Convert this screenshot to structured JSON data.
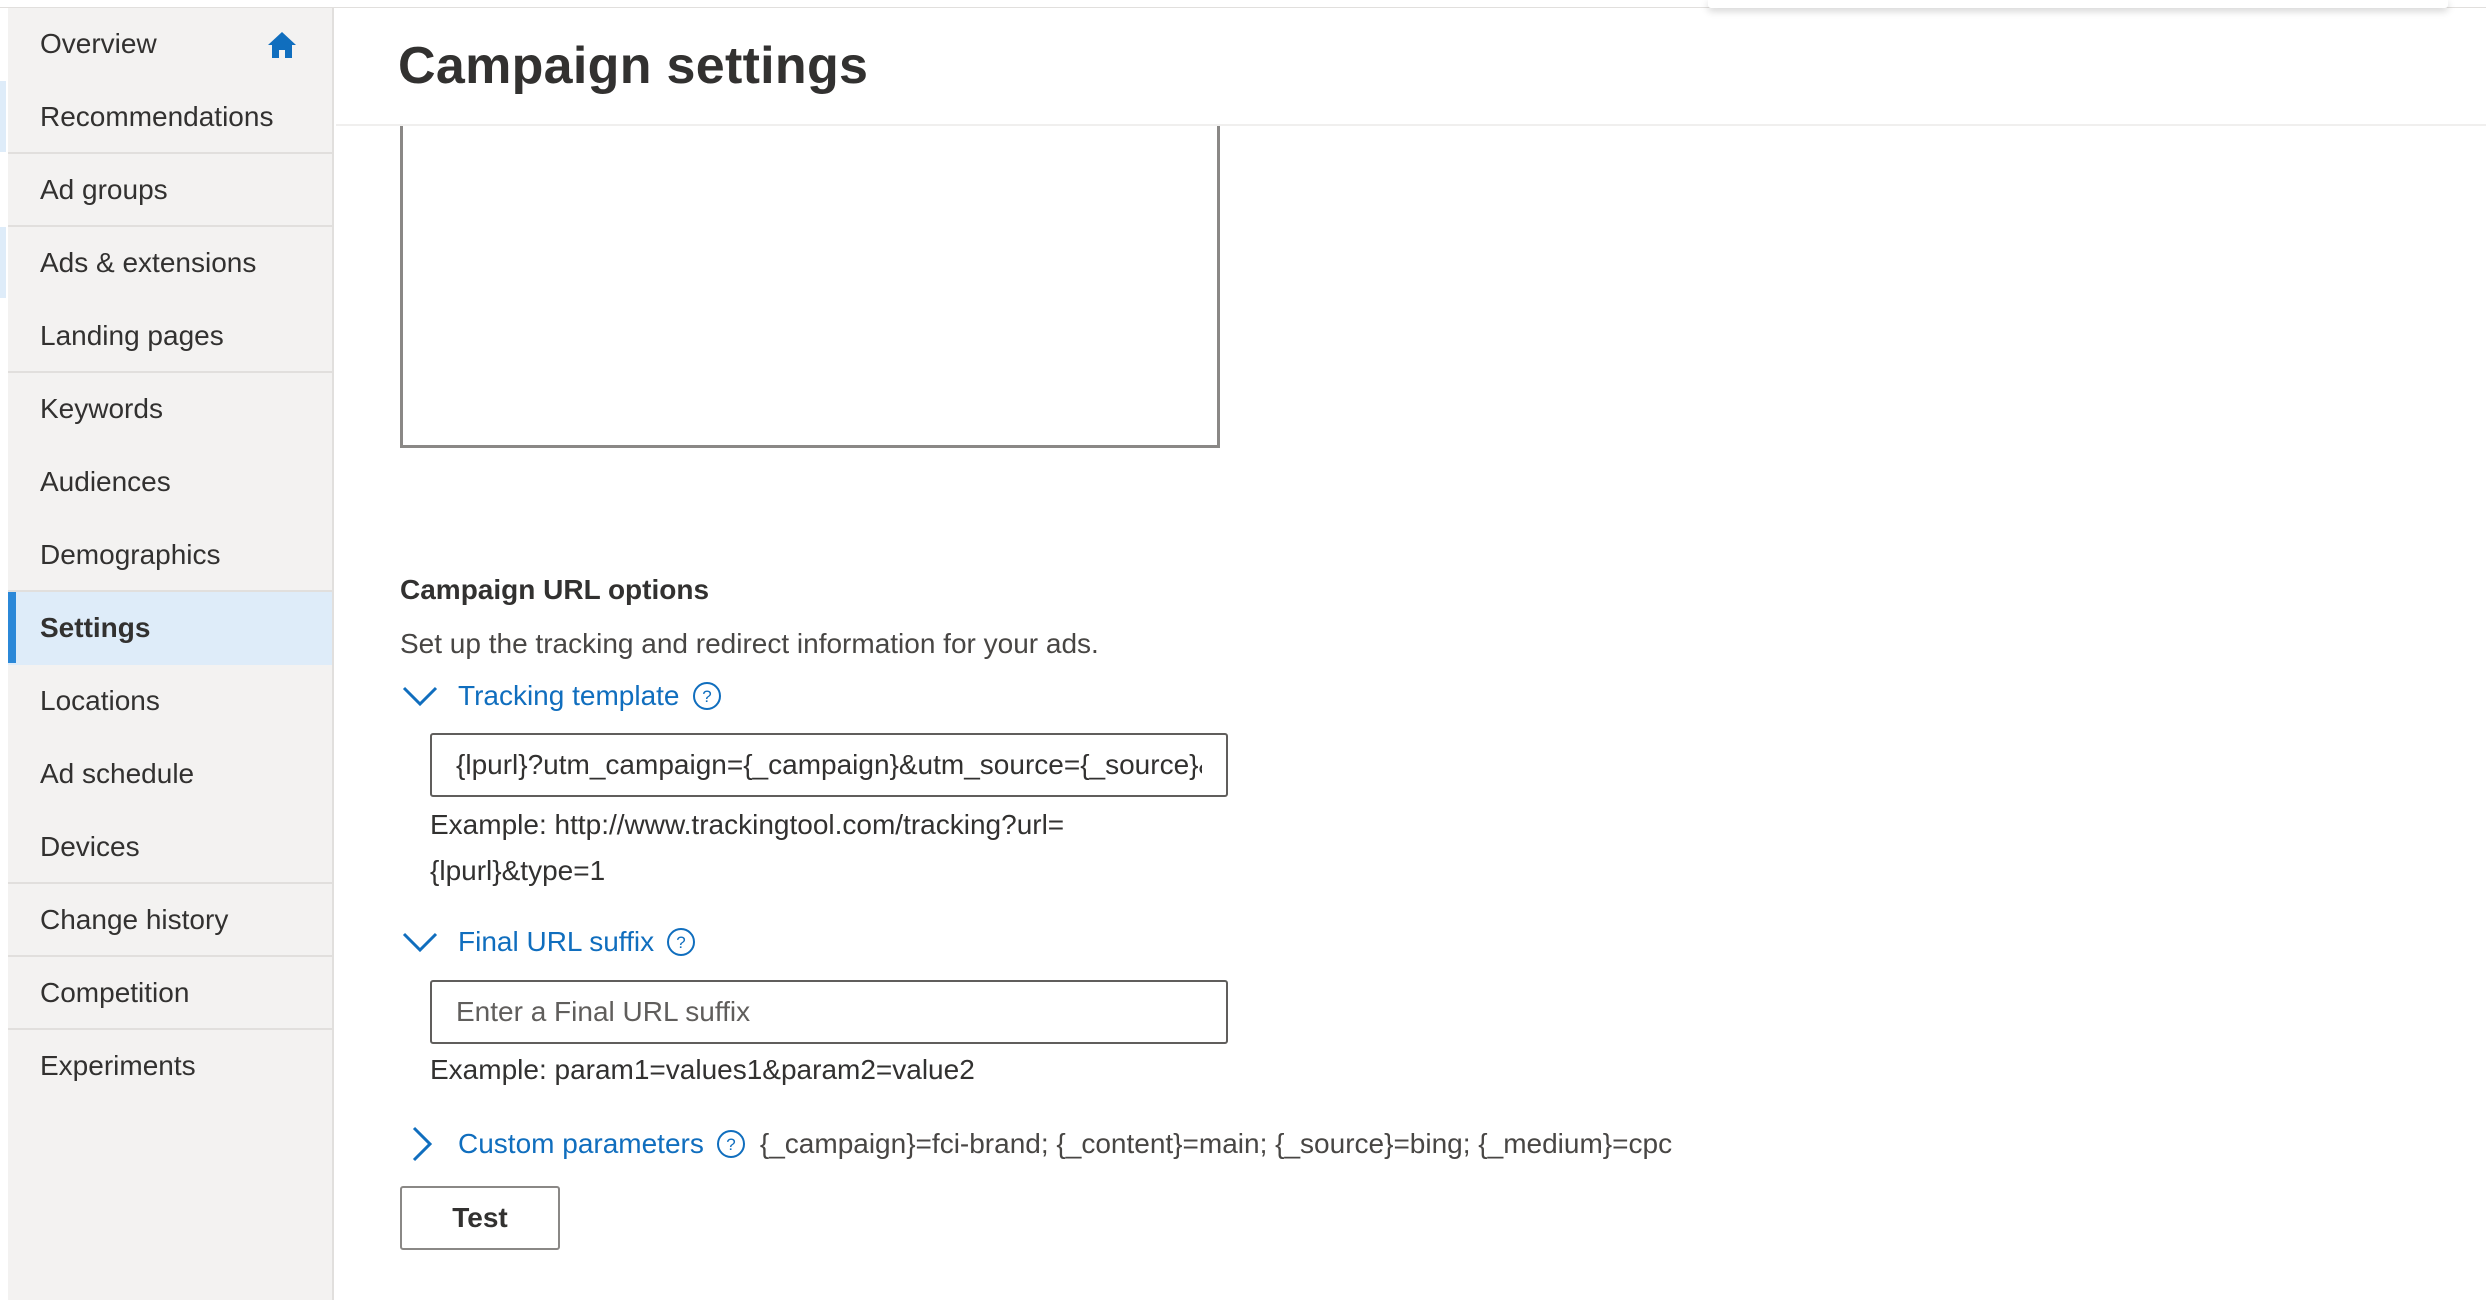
{
  "colors": {
    "accent": "#106ebe",
    "nav_active_bg": "#deecf9",
    "nav_active_bar": "#2b88d8",
    "sidebar_bg": "#f3f2f1"
  },
  "sidebar": {
    "items": [
      {
        "label": "Overview",
        "icon": "home-icon"
      },
      {
        "label": "Recommendations"
      },
      {
        "label": "Ad groups"
      },
      {
        "label": "Ads & extensions"
      },
      {
        "label": "Landing pages"
      },
      {
        "label": "Keywords"
      },
      {
        "label": "Audiences"
      },
      {
        "label": "Demographics"
      },
      {
        "label": "Settings",
        "active": true
      },
      {
        "label": "Locations"
      },
      {
        "label": "Ad schedule"
      },
      {
        "label": "Devices"
      },
      {
        "label": "Change history"
      },
      {
        "label": "Competition"
      },
      {
        "label": "Experiments"
      }
    ]
  },
  "header": {
    "title": "Campaign settings"
  },
  "url_options": {
    "title": "Campaign URL options",
    "description": "Set up the tracking and redirect information for your ads.",
    "tracking_template": {
      "label": "Tracking template",
      "value": "{lpurl}?utm_campaign={_campaign}&utm_source={_source}&",
      "example": "Example: http://www.trackingtool.com/tracking?url={lpurl}&type=1"
    },
    "final_url_suffix": {
      "label": "Final URL suffix",
      "placeholder": "Enter a Final URL suffix",
      "example": "Example: param1=values1&param2=value2"
    },
    "custom_parameters": {
      "label": "Custom parameters",
      "value": "{_campaign}=fci-brand; {_content}=main; {_source}=bing; {_medium}=cpc"
    },
    "test_label": "Test"
  }
}
